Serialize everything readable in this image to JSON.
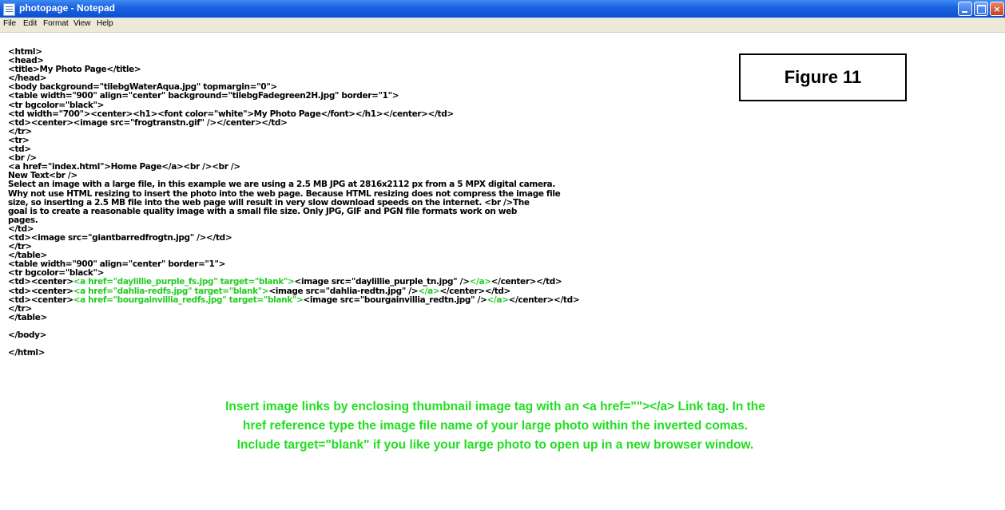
{
  "window": {
    "title": "photopage - Notepad",
    "icon": "notepad-icon",
    "buttons": {
      "minimize": "minimize-icon",
      "maximize": "maximize-icon",
      "close": "×"
    }
  },
  "menu": [
    "File",
    "Edit",
    "Format",
    "View",
    "Help"
  ],
  "editor": {
    "lines": [
      "<html>",
      "<head>",
      "<title>My Photo Page</title>",
      "</head>",
      "<body background=\"tilebgWaterAqua.jpg\" topmargin=\"0\">",
      "<table width=\"900\" align=\"center\" background=\"tilebgFadegreen2H.jpg\" border=\"1\">",
      "<tr bgcolor=\"black\">",
      "<td width=\"700\"><center><h1><font color=\"white\">My Photo Page</font></h1></center></td>",
      "<td><center><image src=\"frogtranstn.gif\" /></center></td>",
      "</tr>",
      "<tr>",
      "<td>",
      "<br />",
      "<a href=\"index.html\">Home Page</a><br /><br />",
      "New Text<br />",
      "Select an image with a large file, in this example we are using a 2.5 MB JPG at 2816x2112 px from a 5 MPX digital camera.",
      "Why not use HTML resizing to insert the photo into the web page. Because HTML resizing does not compress the image file",
      "size, so inserting a 2.5 MB file into the web page will result in very slow download speeds on the internet. <br />The",
      "goal is to create a reasonable quality image with a small file size. Only JPG, GIF and PGN file formats work on web",
      "pages.",
      "</td>",
      "<td><image src=\"giantbarredfrogtn.jpg\" /></td>",
      "</tr>",
      "</table>",
      "<table width=\"900\" align=\"center\" border=\"1\">",
      "<tr bgcolor=\"black\">",
      "<td><center><a href=\"daylillie_purple_fs.jpg\" target=\"blank\"><image src=\"daylillie_purple_tn.jpg\" /></a></center></td>",
      "<td><center><a href=\"dahlia-redfs.jpg\" target=\"blank\"><image src=\"dahlia-redtn.jpg\" /></a></center></td>",
      "<td><center><a href=\"bourgainvillia_redfs.jpg\" target=\"blank\"><image src=\"bourgainvillia_redtn.jpg\" /></a></center></td>",
      "</tr>",
      "</table>",
      "",
      "</body>",
      "",
      "</html>"
    ],
    "highlight_color": "#22cc22",
    "highlights": [
      {
        "line": 26,
        "text": "<a href=\"daylillie_purple_fs.jpg\" target=\"blank\">"
      },
      {
        "line": 27,
        "text": "<a href=\"dahlia-redfs.jpg\" target=\"blank\">"
      },
      {
        "line": 28,
        "text": "<a href=\"bourgainvillia_redfs.jpg\" target=\"blank\">"
      },
      {
        "line": 26,
        "text": "</a>"
      },
      {
        "line": 27,
        "text": "</a>"
      },
      {
        "line": 28,
        "text": "</a>"
      }
    ]
  },
  "figure_label": "Figure 11",
  "annotation": {
    "color": "#22dd22",
    "lines": [
      "Insert image links by enclosing thumbnail image tag with an <a href=\"\"></a> Link tag. In the",
      "href reference type the image file name of your large photo within the inverted comas.",
      "Include target=\"blank\" if you like your large photo to open up in a new browser window."
    ]
  }
}
